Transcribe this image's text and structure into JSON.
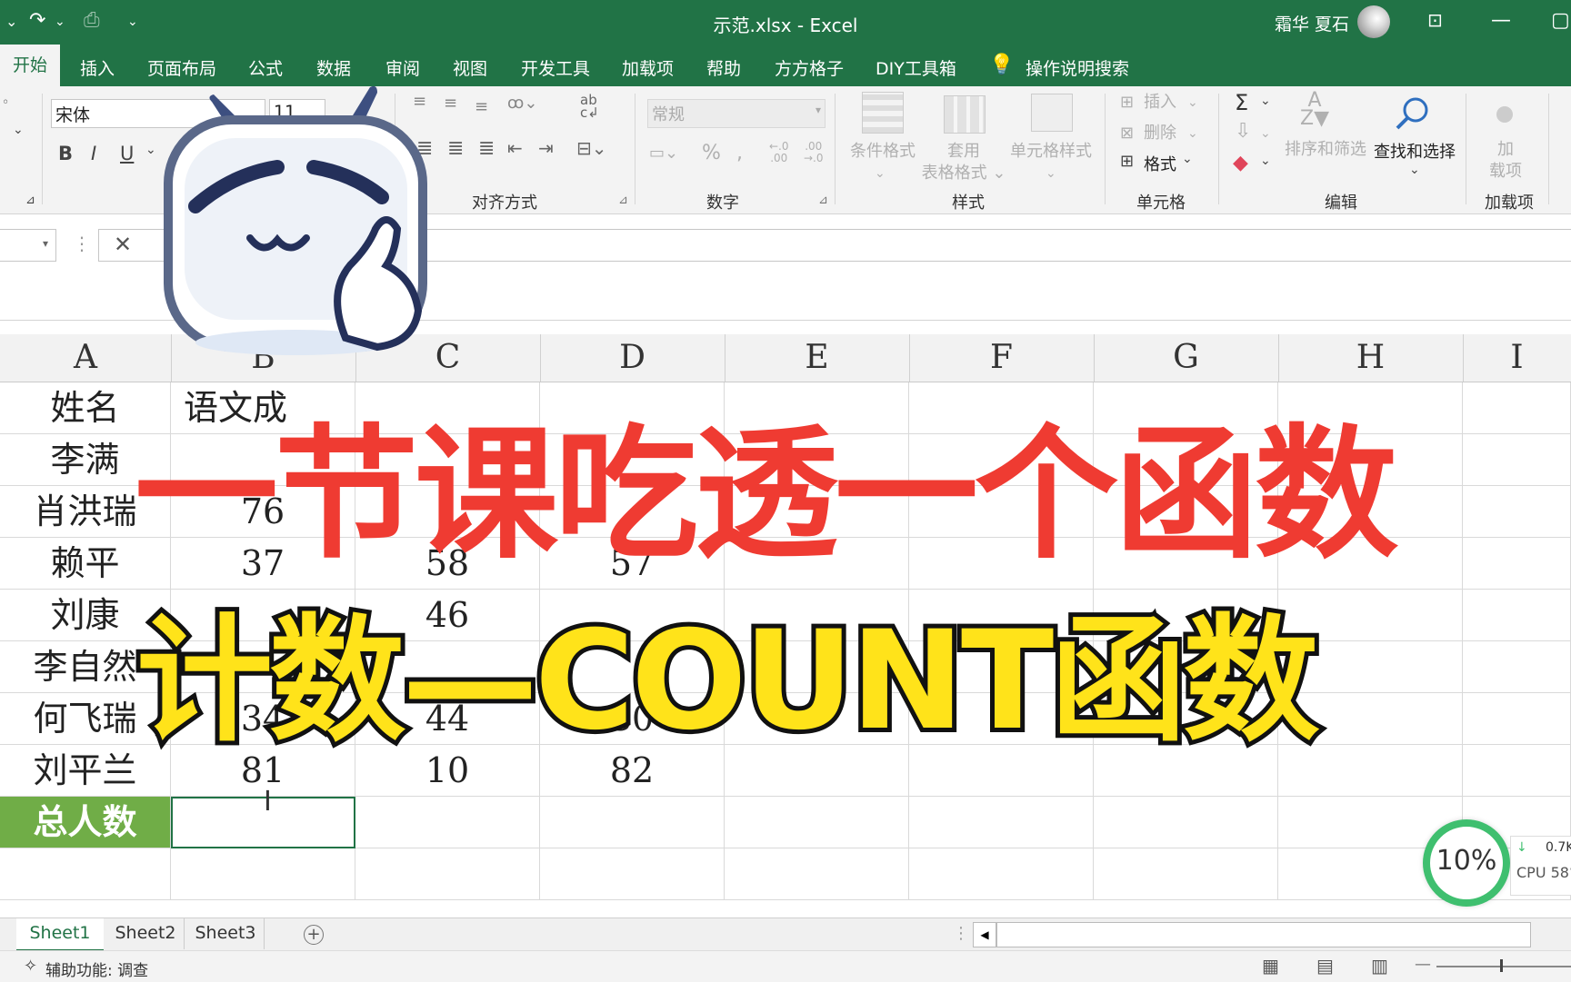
{
  "window": {
    "title": "示范.xlsx  -  Excel",
    "user": "霜华 夏石"
  },
  "tabs": [
    "开始",
    "插入",
    "页面布局",
    "公式",
    "数据",
    "审阅",
    "视图",
    "开发工具",
    "加载项",
    "帮助",
    "方方格子",
    "DIY工具箱"
  ],
  "tell_me": "操作说明搜索",
  "ribbon": {
    "font_name": "宋体",
    "font_size": "11",
    "number_format": "常规",
    "groups": {
      "align": "对齐方式",
      "number": "数字",
      "styles": "样式",
      "cells": "单元格",
      "editing": "编辑",
      "addins": "加载项"
    },
    "styles": {
      "conditional": "条件格式",
      "table_format_1": "套用",
      "table_format_2": "表格格式",
      "cell_styles": "单元格样式"
    },
    "cells": {
      "insert": "插入",
      "delete": "删除",
      "format": "格式"
    },
    "editing": {
      "sort_filter": "排序和筛选",
      "find_select": "查找和选择"
    },
    "addins": {
      "add_1": "加",
      "add_2": "载项"
    }
  },
  "sheet": {
    "columns": [
      "A",
      "B",
      "C",
      "D",
      "E",
      "F",
      "G",
      "H",
      "I"
    ],
    "rows": [
      [
        "姓名",
        "语文成",
        "",
        ""
      ],
      [
        "李满",
        "",
        "",
        ""
      ],
      [
        "肖洪瑞",
        "76",
        "",
        ""
      ],
      [
        "赖平",
        "37",
        "58",
        "57"
      ],
      [
        "刘康",
        "",
        "46",
        ""
      ],
      [
        "李自然",
        "",
        "",
        ""
      ],
      [
        "何飞瑞",
        "34",
        "44",
        "30"
      ],
      [
        "刘平兰",
        "81",
        "10",
        "82"
      ]
    ],
    "total_label": "总人数"
  },
  "sheet_tabs": [
    "Sheet1",
    "Sheet2",
    "Sheet3"
  ],
  "status": {
    "accessibility": "辅助功能: 调查"
  },
  "overlay": {
    "headline": "一节课吃透一个函数",
    "subtitle": "计数—COUNT函数",
    "percent": "10%",
    "net_speed": "0.7K",
    "cpu": "CPU 58°"
  },
  "colors": {
    "excel_green": "#217346",
    "headline_red": "#ef3b32",
    "subtitle_yellow": "#ffe31a",
    "total_cell_green": "#70ad47"
  }
}
